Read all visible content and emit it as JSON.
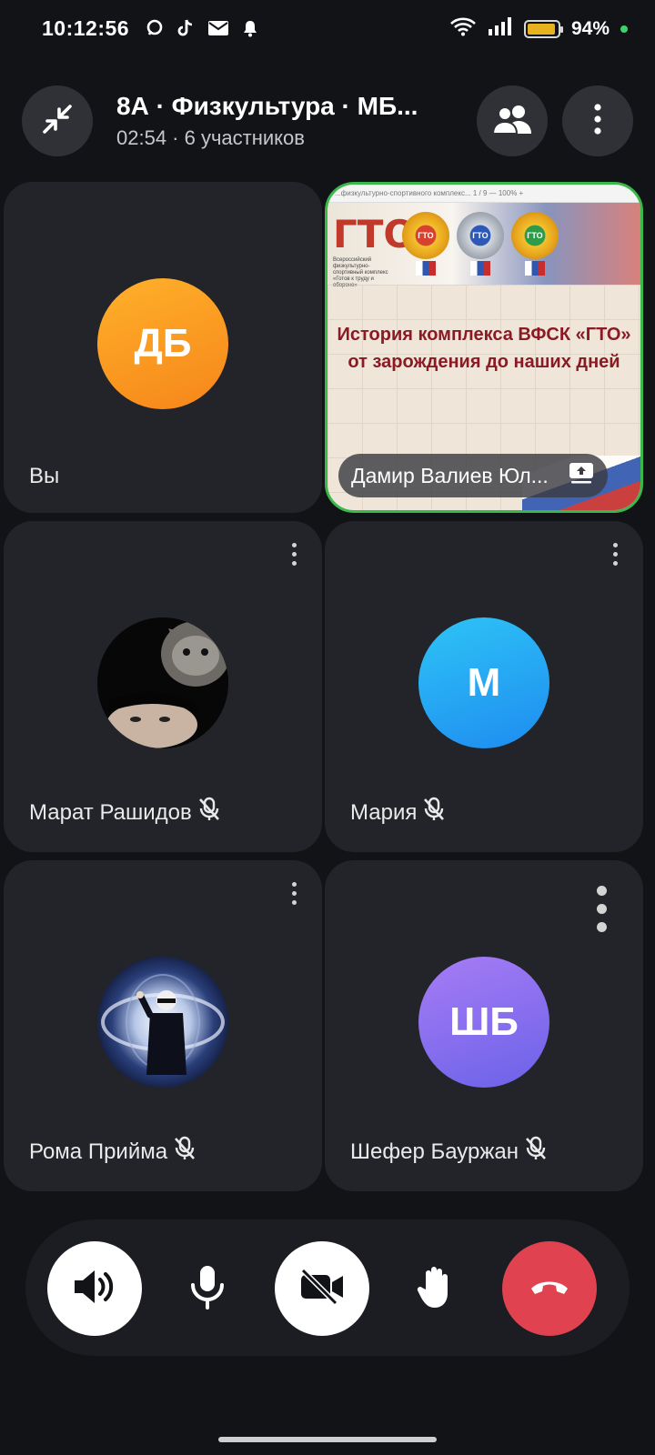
{
  "status_bar": {
    "time": "10:12:56",
    "battery_pct": "94%",
    "battery_level": 0.94,
    "icons": [
      "chat-bubble-icon",
      "tiktok-icon",
      "mail-icon",
      "bell-icon",
      "wifi-icon",
      "signal-icon",
      "battery-icon"
    ]
  },
  "header": {
    "title": "8А · Физкультура · МБ...",
    "subtitle": "02:54 · 6 участников"
  },
  "tiles": {
    "self": {
      "initials": "ДБ",
      "name": "Вы",
      "color_from": "#ffb02a",
      "color_to": "#f6861a"
    },
    "share": {
      "presenter": "Дамир Валиев Юл...",
      "heading_line1": "История комплекса ВФСК «ГТО»",
      "heading_line2": "от зарождения до наших дней",
      "logo_text": "ГТО",
      "logo_sub": "Всероссийский физкультурно-спортивный комплекс «Готов к труду и обороне»",
      "medal_label": "ГТО",
      "toolbar_text": "...физкультурно-спортивного комплекс...   1 / 9    —   100%   +",
      "border_color": "#3ab84a"
    },
    "marat": {
      "name": "Марат Рашидов"
    },
    "maria": {
      "initials": "М",
      "name": "Мария",
      "color_from": "#2ec4f6",
      "color_to": "#1e8cf0"
    },
    "roma": {
      "name": "Рома Прийма"
    },
    "shefer": {
      "initials": "ШБ",
      "name": "Шефер Бауржан",
      "color_from": "#a77cf5",
      "color_to": "#6b62e8"
    }
  },
  "controls": {
    "speaker": "speaker-icon",
    "mic": "microphone-icon",
    "camera": "camera-off-icon",
    "raise_hand": "hand-icon",
    "end_call": "end-call-icon",
    "end_call_color": "#e0434f"
  }
}
